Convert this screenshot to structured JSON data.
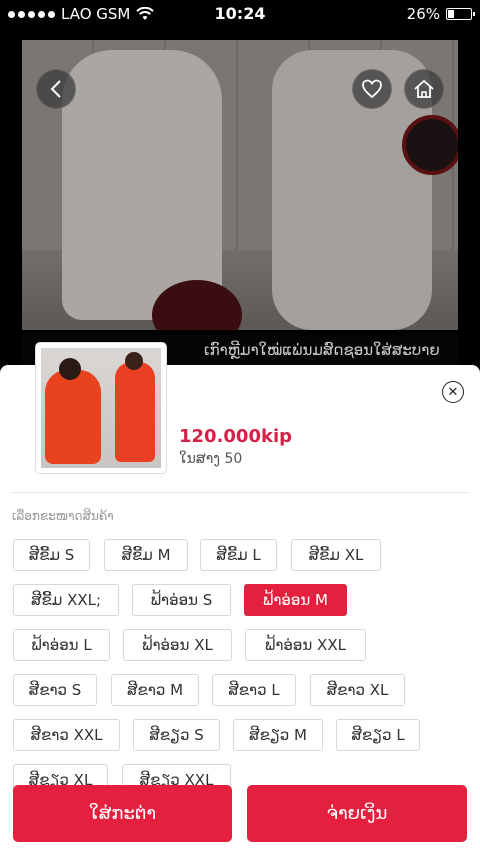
{
  "status_bar": {
    "carrier": "LAO GSM",
    "time": "10:24",
    "battery": "26%"
  },
  "product": {
    "title_snippet": "ເກົາຫຼີມາໃໝ່ແພ່ນມສົດຊອນໃສ່ສະບາຍ",
    "price": "120.000kip",
    "stock": "ໃນສາງ 50"
  },
  "sheet": {
    "choose_label": "ເລືອກຂະໜາດສິນຄ້າ",
    "close_symbol": "✕"
  },
  "options": [
    {
      "label": "ສີຂີ້ມ S",
      "selected": false
    },
    {
      "label": "ສີຂີ້ມ M",
      "selected": false
    },
    {
      "label": "ສີຂີ້ມ L",
      "selected": false
    },
    {
      "label": "ສີຂີ້ມ XL",
      "selected": false
    },
    {
      "label": "ສີຂີ້ມ XXL;",
      "selected": false
    },
    {
      "label": "ຟ້າອ່ອນ S",
      "selected": false
    },
    {
      "label": "ຟ້າອ່ອນ M",
      "selected": true
    },
    {
      "label": "ຟ້າອ່ອນ L",
      "selected": false
    },
    {
      "label": "ຟ້າອ່ອນ XL",
      "selected": false
    },
    {
      "label": "ຟ້າອ່ອນ XXL",
      "selected": false
    },
    {
      "label": "ສີຂາວ S",
      "selected": false
    },
    {
      "label": "ສີຂາວ M",
      "selected": false
    },
    {
      "label": "ສີຂາວ L",
      "selected": false
    },
    {
      "label": "ສີຂາວ XL",
      "selected": false
    },
    {
      "label": "ສີຂາວ XXL",
      "selected": false
    },
    {
      "label": "ສີຂຽວ S",
      "selected": false
    },
    {
      "label": "ສີຂຽວ M",
      "selected": false
    },
    {
      "label": "ສີຂຽວ L",
      "selected": false
    },
    {
      "label": "ສີຂຽວ XL",
      "selected": false
    },
    {
      "label": "ສີຂຽວ XXL",
      "selected": false
    }
  ],
  "actions": {
    "add_to_cart": "ໃສ່ກະຕ່າ",
    "pay": "ຈ່າຍເງິນ"
  },
  "colors": {
    "accent": "#e5203f",
    "price": "#d32247"
  },
  "icons": [
    "back-icon",
    "heart-icon",
    "home-icon",
    "wifi-icon",
    "battery-icon",
    "close-icon"
  ]
}
